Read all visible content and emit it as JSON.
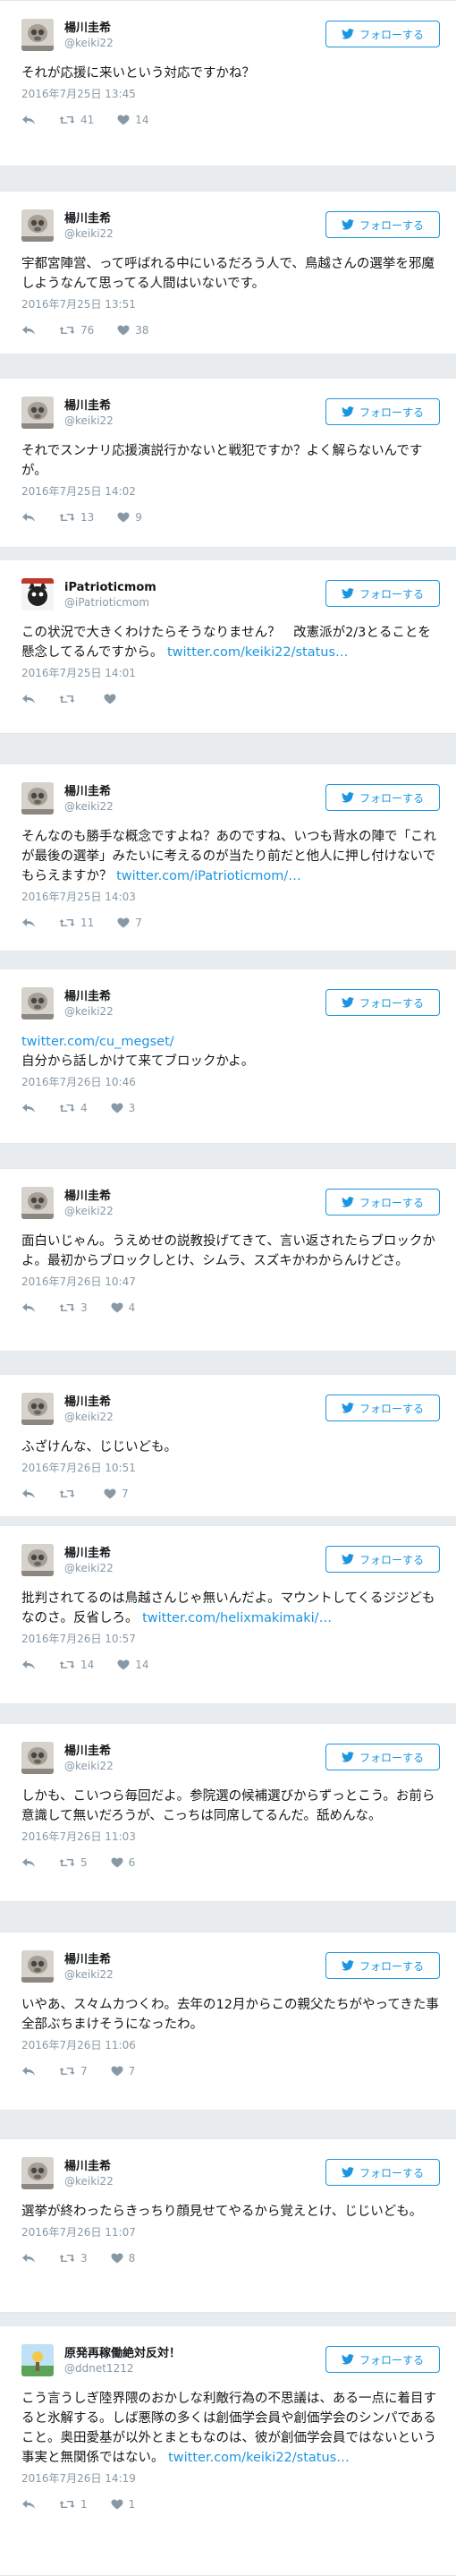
{
  "follow_label": "フォローする",
  "colors": {
    "link": "#1b95e0",
    "meta": "#8899a6",
    "background": "#e9ecef"
  },
  "icons": {
    "reply": "reply-icon",
    "retweet": "retweet-icon",
    "like": "heart-icon",
    "follow": "twitter-bird-icon"
  },
  "tweets": [
    {
      "name": "楊川圭希",
      "handle": "@keiki22",
      "text": "それが応援に来いという対応ですかね？",
      "link": "",
      "date": "2016年7月25日 13:45",
      "retweets": "41",
      "likes": "14"
    },
    {
      "name": "楊川圭希",
      "handle": "@keiki22",
      "text": "宇都宮陣営、って呼ばれる中にいるだろう人で、鳥越さんの選挙を邪魔しようなんて思ってる人間はいないです。",
      "link": "",
      "date": "2016年7月25日 13:51",
      "retweets": "76",
      "likes": "38"
    },
    {
      "name": "楊川圭希",
      "handle": "@keiki22",
      "text": "それでスンナリ応援演説行かないと戦犯ですか？よく解らないんですが。",
      "link": "",
      "date": "2016年7月25日 14:02",
      "retweets": "13",
      "likes": "9"
    },
    {
      "name": "iPatrioticmom",
      "handle": "@iPatrioticmom",
      "text": "この状況で大きくわけたらそうなりません？　改憲派が2/3とることを懸念してるんですから。",
      "link": "twitter.com/keiki22/status…",
      "date": "2016年7月25日 14:01",
      "retweets": "",
      "likes": ""
    },
    {
      "name": "楊川圭希",
      "handle": "@keiki22",
      "text": "そんなのも勝手な概念ですよね？あのですね、いつも背水の陣で「これが最後の選挙」みたいに考えるのが当たり前だと他人に押し付けないでもらえますか？",
      "link": "twitter.com/iPatrioticmom/…",
      "date": "2016年7月25日 14:03",
      "retweets": "11",
      "likes": "7"
    },
    {
      "name": "楊川圭希",
      "handle": "@keiki22",
      "text": "",
      "link": "twitter.com/cu_megset/",
      "text2": "自分から話しかけて来てブロックかよ。",
      "date": "2016年7月26日 10:46",
      "retweets": "4",
      "likes": "3"
    },
    {
      "name": "楊川圭希",
      "handle": "@keiki22",
      "text": "面白いじゃん。うえめせの説教投げてきて、言い返されたらブロックかよ。最初からブロックしとけ、シムラ、スズキかわからんけどさ。",
      "link": "",
      "date": "2016年7月26日 10:47",
      "retweets": "3",
      "likes": "4"
    },
    {
      "name": "楊川圭希",
      "handle": "@keiki22",
      "text": "ふざけんな、じじいども。",
      "link": "",
      "date": "2016年7月26日 10:51",
      "retweets": "",
      "likes": "7"
    },
    {
      "name": "楊川圭希",
      "handle": "@keiki22",
      "text": "批判されてるのは鳥越さんじゃ無いんだよ。マウントしてくるジジどもなのさ。反省しろ。",
      "link": "twitter.com/helixmakimaki/…",
      "date": "2016年7月26日 10:57",
      "retweets": "14",
      "likes": "14"
    },
    {
      "name": "楊川圭希",
      "handle": "@keiki22",
      "text": "しかも、こいつら毎回だよ。参院選の候補選びからずっとこう。お前ら意識して無いだろうが、こっちは同席してるんだ。舐めんな。",
      "link": "",
      "date": "2016年7月26日 11:03",
      "retweets": "5",
      "likes": "6"
    },
    {
      "name": "楊川圭希",
      "handle": "@keiki22",
      "text": "いやあ、ス々ムカつくわ。去年の12月からこの親父たちがやってきた事全部ぶちまけそうになったわ。",
      "link": "",
      "date": "2016年7月26日 11:06",
      "retweets": "7",
      "likes": "7"
    },
    {
      "name": "楊川圭希",
      "handle": "@keiki22",
      "text": "選挙が終わったらきっちり顔見せてやるから覚えとけ、じじいども。",
      "link": "",
      "date": "2016年7月26日 11:07",
      "retweets": "3",
      "likes": "8"
    },
    {
      "name": "原発再稼働絶対反対！",
      "handle": "@ddnet1212",
      "text": "こう言うしぎ陸界隈のおかしな利敵行為の不思議は、ある一点に着目すると氷解する。しば悪隊の多くは創価学会員や創価学会のシンパであること。奥田愛基が以外とまともなのは、彼が創価学会員ではないという事実と無関係ではない。",
      "link": "twitter.com/keiki22/status…",
      "date": "2016年7月26日 14:19",
      "retweets": "1",
      "likes": "1"
    }
  ]
}
